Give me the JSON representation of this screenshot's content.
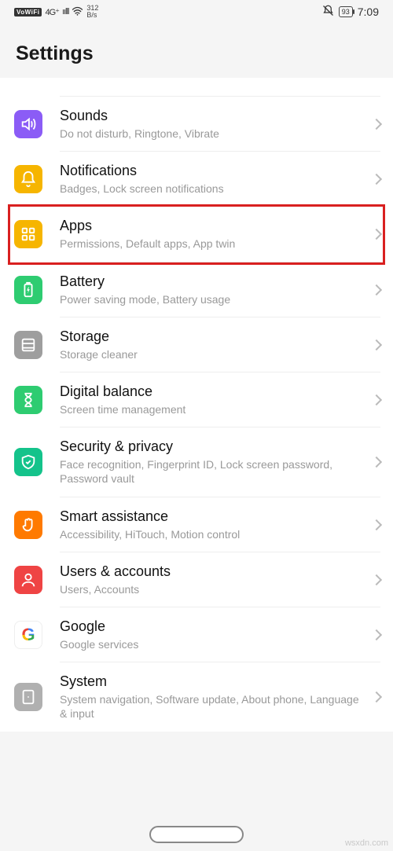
{
  "status": {
    "vowifi": "VoWiFi",
    "signal_gen": "4G⁺",
    "net_speed_top": "312",
    "net_speed_bottom": "B/s",
    "battery": "93",
    "time": "7:09"
  },
  "page_title": "Settings",
  "items": [
    {
      "title": "Sounds",
      "subtitle": "Do not disturb, Ringtone, Vibrate",
      "icon": "sound-icon",
      "color": "c-purple"
    },
    {
      "title": "Notifications",
      "subtitle": "Badges, Lock screen notifications",
      "icon": "bell-icon",
      "color": "c-yellow"
    },
    {
      "title": "Apps",
      "subtitle": "Permissions, Default apps, App twin",
      "icon": "apps-icon",
      "color": "c-yellow",
      "highlighted": true
    },
    {
      "title": "Battery",
      "subtitle": "Power saving mode, Battery usage",
      "icon": "battery-icon",
      "color": "c-green"
    },
    {
      "title": "Storage",
      "subtitle": "Storage cleaner",
      "icon": "storage-icon",
      "color": "c-grey"
    },
    {
      "title": "Digital balance",
      "subtitle": "Screen time management",
      "icon": "hourglass-icon",
      "color": "c-green"
    },
    {
      "title": "Security & privacy",
      "subtitle": "Face recognition, Fingerprint ID, Lock screen password, Password vault",
      "icon": "shield-icon",
      "color": "c-teal"
    },
    {
      "title": "Smart assistance",
      "subtitle": "Accessibility, HiTouch, Motion control",
      "icon": "hand-icon",
      "color": "c-orange"
    },
    {
      "title": "Users & accounts",
      "subtitle": "Users, Accounts",
      "icon": "user-icon",
      "color": "c-red"
    },
    {
      "title": "Google",
      "subtitle": "Google services",
      "icon": "google-icon",
      "color": "c-google"
    },
    {
      "title": "System",
      "subtitle": "System navigation, Software update, About phone, Language & input",
      "icon": "system-icon",
      "color": "c-grey2"
    }
  ],
  "watermark": "wsxdn.com"
}
